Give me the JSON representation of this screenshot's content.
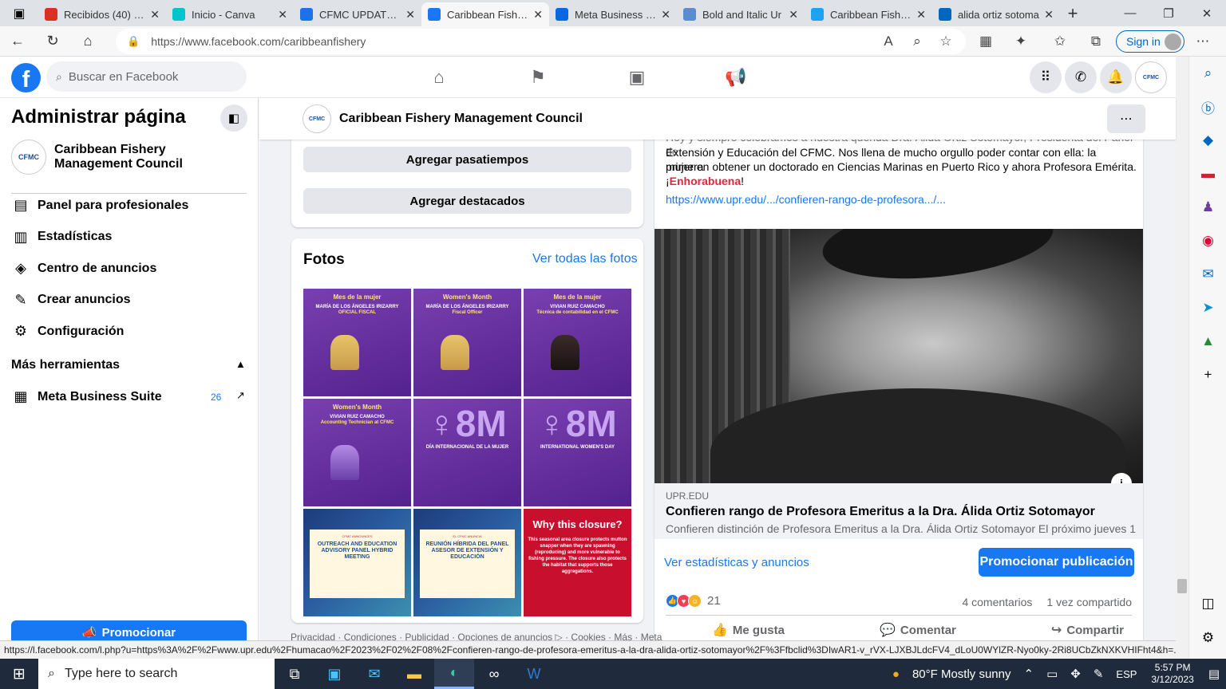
{
  "browser": {
    "tabs": [
      {
        "title": "Recibidos (40) - cr",
        "icon": "gmail-icon",
        "color": "#d93025"
      },
      {
        "title": "Inicio - Canva",
        "icon": "canva-icon",
        "color": "#00c4cc"
      },
      {
        "title": "CFMC UPDATES F",
        "icon": "document-icon",
        "color": "#1a73e8"
      },
      {
        "title": "Caribbean Fishery",
        "icon": "facebook-icon",
        "color": "#1877f2"
      },
      {
        "title": "Meta Business Su",
        "icon": "meta-icon",
        "color": "#0668e1"
      },
      {
        "title": "Bold and Italic Ur",
        "icon": "text-icon",
        "color": "#5b8bd0"
      },
      {
        "title": "Caribbean Fishery",
        "icon": "twitter-icon",
        "color": "#1da1f2"
      },
      {
        "title": "alida ortiz sotoma",
        "icon": "search-icon",
        "color": "#0067c0"
      }
    ],
    "url": "https://www.facebook.com/caribbeanfishery",
    "signin": "Sign in"
  },
  "fb": {
    "search_placeholder": "Buscar en Facebook",
    "manage_title": "Administrar página",
    "page_name": "Caribbean Fishery Management Council",
    "logo_text": "CFMC",
    "menu": [
      {
        "label": "Panel para profesionales",
        "icon": "dashboard-icon"
      },
      {
        "label": "Estadísticas",
        "icon": "chart-icon"
      },
      {
        "label": "Centro de anuncios",
        "icon": "ads-icon"
      },
      {
        "label": "Crear anuncios",
        "icon": "edit-icon"
      },
      {
        "label": "Configuración",
        "icon": "gear-icon"
      }
    ],
    "more_tools": "Más herramientas",
    "mbs_label": "Meta Business Suite",
    "mbs_badge": "26",
    "promote": "Promocionar"
  },
  "left": {
    "btn_hobbies": "Agregar pasatiempos",
    "btn_featured": "Agregar destacados",
    "fotos_title": "Fotos",
    "fotos_link": "Ver todas las fotos",
    "photos": [
      {
        "t": "Mes de la mujer",
        "n": "MARÍA DE LOS ÁNGELES IRIZARRY",
        "r": "OFICIAL FISCAL"
      },
      {
        "t": "Women's Month",
        "n": "MARÍA DE LOS ÁNGELES IRIZARRY",
        "r": "Fiscal Officer"
      },
      {
        "t": "Mes de la mujer",
        "n": "VIVIAN RUIZ CAMACHO",
        "r": "Técnica de contabilidad en el CFMC"
      },
      {
        "t": "Women's Month",
        "n": "VIVIAN RUIZ CAMACHO",
        "r": "Accounting Technician at CFMC"
      },
      {
        "t": "8M",
        "n": "DÍA INTERNACIONAL DE LA MUJER"
      },
      {
        "t": "8M",
        "n": "INTERNATIONAL WOMEN'S DAY"
      },
      {
        "a": "CFMC ANNOUNCES",
        "h": "OUTREACH AND EDUCATION ADVISORY PANEL HYBRID MEETING"
      },
      {
        "a": "EL CFMC ANUNCIA",
        "h": "REUNIÓN HÍBRIDA DEL PANEL ASESOR DE EXTENSIÓN Y EDUCACIÓN"
      },
      {
        "t": "Why this closure?",
        "b": "This seasonal area closure protects mutton snapper when they are spawning (reproducing) and more vulnerable to fishing pressure. The closure also protects the habitat that supports those aggregations."
      }
    ],
    "footer": "Privacidad · Condiciones · Publicidad · Opciones de anuncios ▷ · Cookies · Más · Meta"
  },
  "post": {
    "line0": "Hoy y siempre celebramos a nuestra querida Dra. Álida Ortiz Sotomayor, Presidenta del Panel de",
    "line1": "Extensión y Educación del CFMC. Nos llena de mucho orgullo poder contar con ella: la primera",
    "line2": "mujer en obtener un doctorado en Ciencias Marinas en Puerto Rico y ahora Profesora Emérita.",
    "line3_pre": "¡",
    "line3_red": "Enhorabuena",
    "line3_post": "!",
    "link": "https://www.upr.edu/.../confieren-rango-de-profesora.../...",
    "lp_domain": "UPR.EDU",
    "lp_title": "Confieren rango de Profesora Emeritus a la Dra. Álida Ortiz Sotomayor",
    "lp_desc": "Confieren distinción de Profesora Emeritus a la Dra. Álida Ortiz Sotomayor El próximo jueves 1...",
    "stats_link": "Ver estadísticas y anuncios",
    "promo": "Promocionar publicación",
    "reactions": "21",
    "comments": "4 comentarios",
    "shares": "1 vez compartido",
    "like": "Me gusta",
    "comment": "Comentar",
    "share": "Compartir"
  },
  "status_url": "https://l.facebook.com/l.php?u=https%3A%2F%2Fwww.upr.edu%2Fhumacao%2F2023%2F02%2F08%2Fconfieren-rango-de-profesora-emeritus-a-la-dra-alida-ortiz-sotomayor%2F%3Ffbclid%3DIwAR1-v_rVX-LJXBJLdcFV4_dLoU0WYlZR-Nyo0ky-2Ri8UCbZkNXKVHIFht4&h=...",
  "taskbar": {
    "search": "Type here to search",
    "weather": "80°F  Mostly sunny",
    "lang": "ESP",
    "time": "5:57 PM",
    "date": "3/12/2023"
  }
}
